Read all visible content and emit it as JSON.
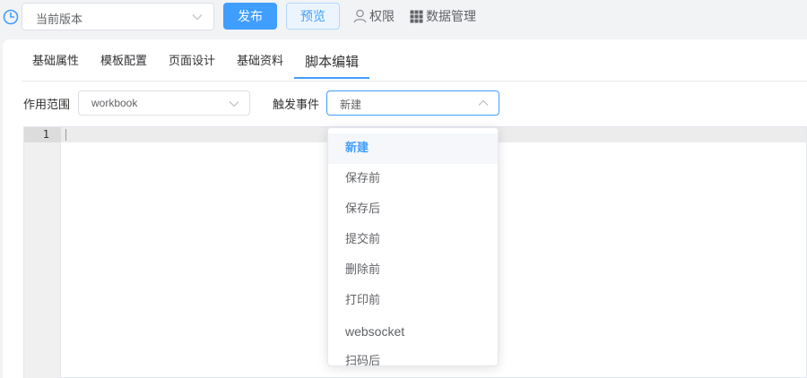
{
  "header": {
    "version_select": {
      "value": "当前版本"
    },
    "publish_label": "发布",
    "preview_label": "预览",
    "permission_label": "权限",
    "data_management_label": "数据管理"
  },
  "tabs": [
    {
      "label": "基础属性",
      "active": false
    },
    {
      "label": "模板配置",
      "active": false
    },
    {
      "label": "页面设计",
      "active": false
    },
    {
      "label": "基础资料",
      "active": false
    },
    {
      "label": "脚本编辑",
      "active": true
    }
  ],
  "form": {
    "scope_label": "作用范围",
    "scope_value": "workbook",
    "event_label": "触发事件",
    "event_value": "新建"
  },
  "editor": {
    "line_numbers": [
      "1"
    ]
  },
  "event_dropdown": {
    "options": [
      "新建",
      "保存前",
      "保存后",
      "提交前",
      "删除前",
      "打印前",
      "websocket",
      "扫码后"
    ],
    "selected_index": 0
  },
  "colors": {
    "primary": "#409eff",
    "primary_light": "#ecf5ff",
    "text": "#303133",
    "muted_text": "#606266",
    "border": "#dcdfe6"
  }
}
